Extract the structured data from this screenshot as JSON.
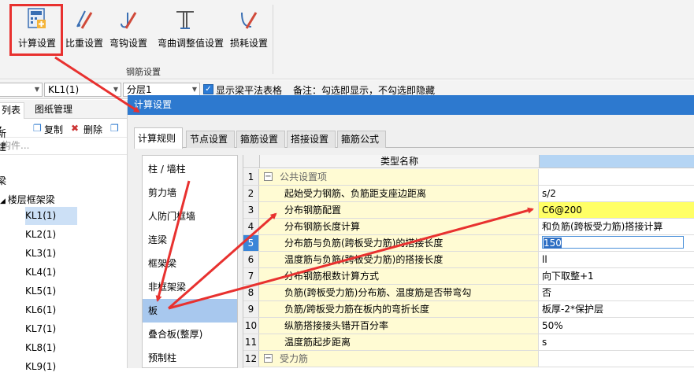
{
  "ribbon": {
    "buttons": [
      {
        "label": "计算设置",
        "icon": "calc-settings-icon"
      },
      {
        "label": "比重设置",
        "icon": "density-settings-icon"
      },
      {
        "label": "弯钩设置",
        "icon": "hook-settings-icon"
      },
      {
        "label": "弯曲调整值设置",
        "icon": "bend-adjust-icon"
      },
      {
        "label": "损耗设置",
        "icon": "loss-settings-icon"
      }
    ],
    "group_label": "钢筋设置"
  },
  "toolbar": {
    "combo1": "",
    "combo2": "KL1(1)",
    "combo3": "分层1",
    "checkbox_label": "显示梁平法表格",
    "note": "备注：勾选即显示，不勾选即隐藏"
  },
  "left_panel": {
    "tabs": [
      "列表",
      "图纸管理"
    ],
    "tools": {
      "new": "新建",
      "copy": "复制",
      "delete": "删除"
    },
    "search_placeholder": "构件...",
    "root_label": "梁",
    "group_label": "楼层框架梁",
    "items": [
      "KL1(1)",
      "KL2(1)",
      "KL3(1)",
      "KL4(1)",
      "KL5(1)",
      "KL6(1)",
      "KL7(1)",
      "KL8(1)",
      "KL9(1)"
    ]
  },
  "dialog": {
    "title": "计算设置",
    "tabs": [
      "计算规则",
      "节点设置",
      "箍筋设置",
      "搭接设置",
      "箍筋公式"
    ],
    "categories": [
      "柱 / 墙柱",
      "剪力墙",
      "人防门框墙",
      "连梁",
      "框架梁",
      "非框架梁",
      "板",
      "叠合板(整厚)",
      "预制柱"
    ],
    "grid": {
      "header_name": "类型名称",
      "rows": [
        {
          "num": "1",
          "name": "公共设置项",
          "value": ""
        },
        {
          "num": "2",
          "name": "起始受力钢筋、负筋距支座边距离",
          "value": "s/2"
        },
        {
          "num": "3",
          "name": "分布钢筋配置",
          "value": "C6@200"
        },
        {
          "num": "4",
          "name": "分布钢筋长度计算",
          "value": "和负筋(跨板受力筋)搭接计算"
        },
        {
          "num": "5",
          "name": "分布筋与负筋(跨板受力筋)的搭接长度",
          "value": "150"
        },
        {
          "num": "6",
          "name": "温度筋与负筋(跨板受力筋)的搭接长度",
          "value": "ll"
        },
        {
          "num": "7",
          "name": "分布钢筋根数计算方式",
          "value": "向下取整+1"
        },
        {
          "num": "8",
          "name": "负筋(跨板受力筋)分布筋、温度筋是否带弯勾",
          "value": "否"
        },
        {
          "num": "9",
          "name": "负筋/跨板受力筋在板内的弯折长度",
          "value": "板厚-2*保护层"
        },
        {
          "num": "10",
          "name": "纵筋搭接接头错开百分率",
          "value": "50%"
        },
        {
          "num": "11",
          "name": "温度筋起步距离",
          "value": "s"
        },
        {
          "num": "12",
          "name": "受力筋",
          "value": ""
        }
      ]
    }
  },
  "colors": {
    "accent": "#2d79cf",
    "highlight": "#e8312f",
    "row_bg": "#fffbd3",
    "selected_value_bg": "#ffff66"
  }
}
